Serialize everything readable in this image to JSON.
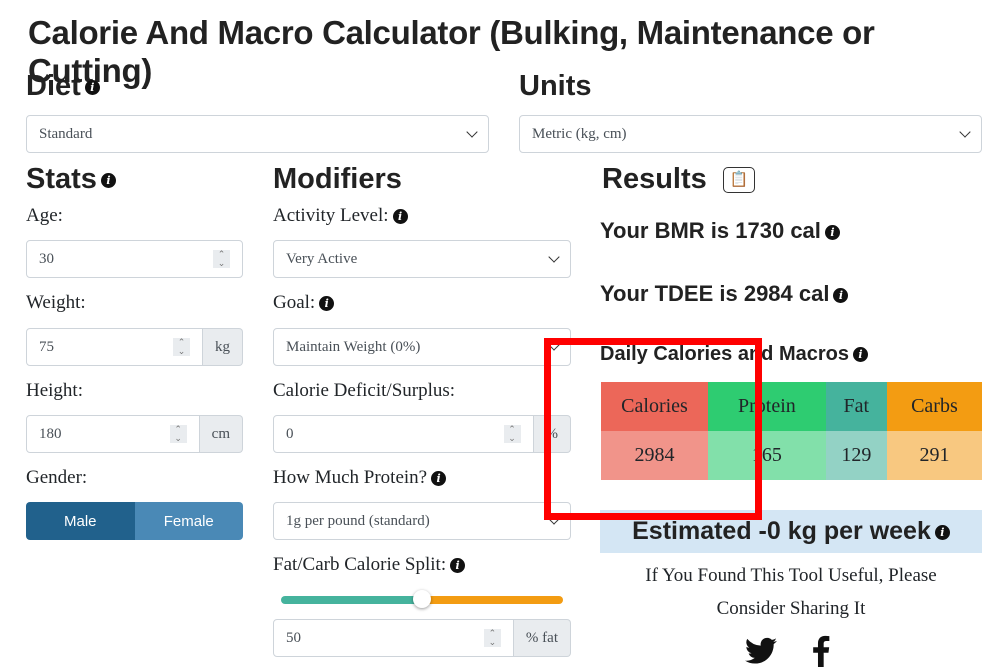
{
  "title": "Calorie And Macro Calculator (Bulking, Maintenance or Cutting)",
  "diet": {
    "heading": "Diet",
    "value": "Standard"
  },
  "units": {
    "heading": "Units",
    "value": "Metric (kg, cm)"
  },
  "stats": {
    "heading": "Stats",
    "age_label": "Age:",
    "age": "30",
    "weight_label": "Weight:",
    "weight": "75",
    "weight_unit": "kg",
    "height_label": "Height:",
    "height": "180",
    "height_unit": "cm",
    "gender_label": "Gender:",
    "male": "Male",
    "female": "Female",
    "selected_gender": "Male"
  },
  "modifiers": {
    "heading": "Modifiers",
    "activity_label": "Activity Level:",
    "activity": "Very Active",
    "goal_label": "Goal:",
    "goal": "Maintain Weight (0%)",
    "deficit_label": "Calorie Deficit/Surplus:",
    "deficit": "0",
    "deficit_unit": "%",
    "protein_label": "How Much Protein?",
    "protein": "1g per pound (standard)",
    "split_label": "Fat/Carb Calorie Split:",
    "split_percent": 50,
    "split": "50",
    "split_unit": "% fat",
    "colors": {
      "fat": "#45b39d",
      "carbs": "#f39c12"
    }
  },
  "results": {
    "heading": "Results",
    "bmr": "Your BMR is 1730 cal",
    "tdee": "Your TDEE is 2984 cal",
    "macros_heading": "Daily Calories and Macros",
    "headers": [
      "Calories",
      "Protein",
      "Fat",
      "Carbs"
    ],
    "values": [
      "2984",
      "165",
      "129",
      "291"
    ],
    "header_colors": [
      "#ec6759",
      "#2ecc71",
      "#45b39d",
      "#f39c12"
    ],
    "value_colors": [
      "#f1948a",
      "#82e0aa",
      "#93d2c5",
      "#f8c880"
    ],
    "estimate": "Estimated -0 kg per week",
    "share_line1": "If You Found This Tool Useful, Please",
    "share_line2": "Consider Sharing It"
  },
  "annotation_color": "#ff0000"
}
